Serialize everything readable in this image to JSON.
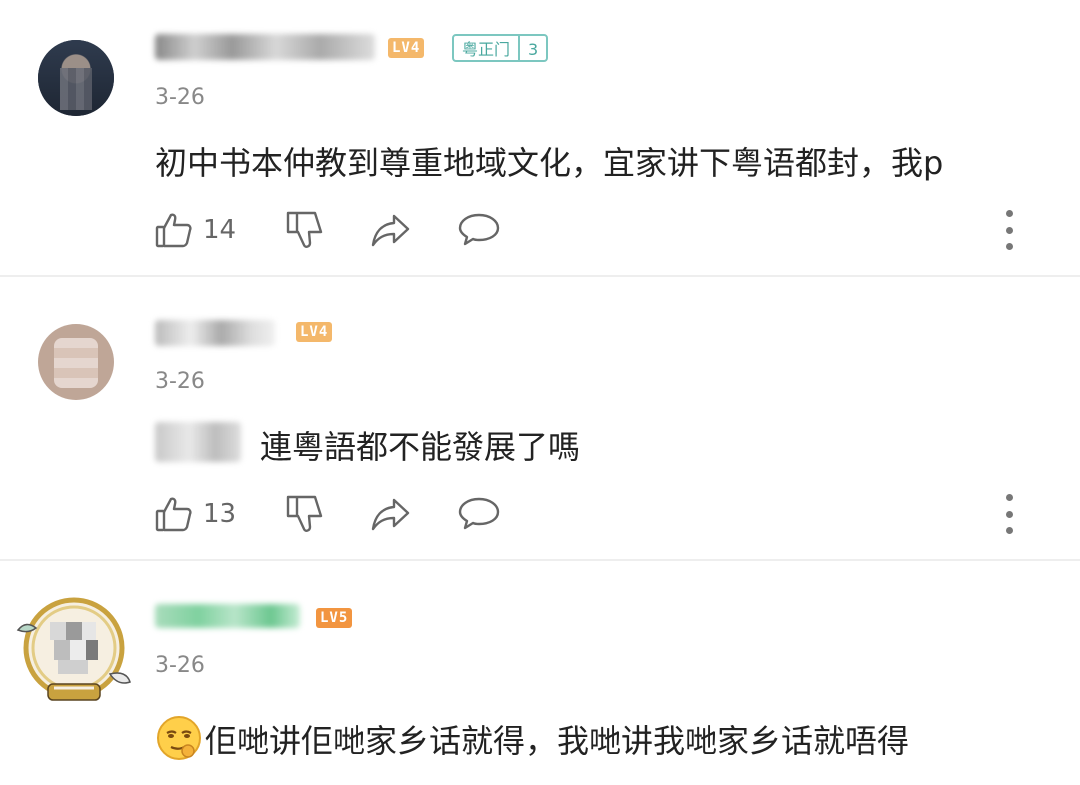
{
  "comments": [
    {
      "level": "LV4",
      "fan_badge": {
        "name": "粤正门",
        "level": "3"
      },
      "date": "3-26",
      "text": "初中书本仲教到尊重地域文化，宜家讲下粤语都封，我p",
      "likes": "14"
    },
    {
      "level": "LV4",
      "date": "3-26",
      "text": "連粵語都不能發展了嗎",
      "likes": "13"
    },
    {
      "level": "LV5",
      "date": "3-26",
      "text": "佢哋讲佢哋家乡话就得，我哋讲我哋家乡话就唔得"
    }
  ],
  "icons": {
    "like": "thumbs-up-icon",
    "dislike": "thumbs-down-icon",
    "share": "share-arrow-icon",
    "reply": "comment-bubble-icon",
    "more": "more-vertical-icon"
  },
  "colors": {
    "lv4": "#f4b86b",
    "lv5": "#f29540",
    "fan_badge": "#7cc7c0",
    "username_green": "#4cc27a"
  }
}
